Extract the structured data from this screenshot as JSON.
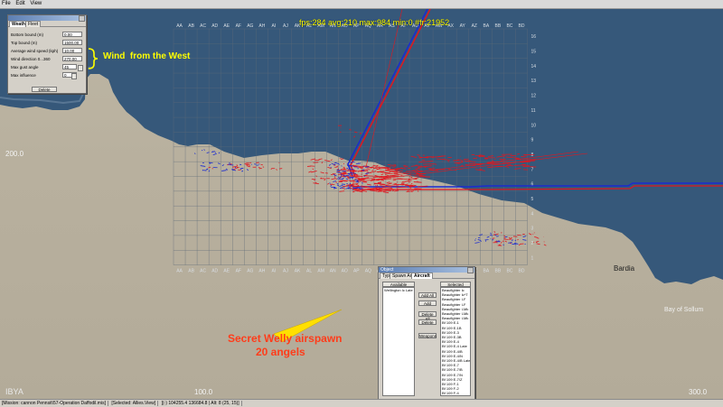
{
  "menu": [
    "File",
    "Edit",
    "View"
  ],
  "fps": "fps:284 avg:210 max:984 min:0 #fr:21952",
  "weather_window": {
    "tabs": [
      "Weather",
      "Fleet"
    ],
    "rows": [
      {
        "label": "Bottom bound (m)",
        "value": "0.00"
      },
      {
        "label": "Top bound (m)",
        "value": "1500.00"
      },
      {
        "label": "Average wind speed (kph)",
        "value": "10.00"
      },
      {
        "label": "Wind direction 0...360",
        "value": "270.00"
      },
      {
        "label": "Max gust angle",
        "value": "45"
      },
      {
        "label": "Max influence",
        "value": "0"
      }
    ],
    "delete_label": "Delete"
  },
  "wind_annotation": "Wind  from the West",
  "object_window": {
    "title": "Object",
    "tabs": [
      "Type",
      "Spawn Area",
      "Aircraft"
    ],
    "available_header": "Available",
    "available_items": [
      "Wellington Ic Late"
    ],
    "buttons": [
      "Add All",
      "Add",
      "Delete All",
      "Delete",
      "Weapons"
    ],
    "selected_header": "Selected",
    "selected_items": [
      "Beaufighter Ic",
      "Beaufighter Ic*T",
      "Beaufighter I-F",
      "Beaufighter I-F",
      "Beaufighter I-Mk",
      "Beaufighter I-Mk",
      "Beaufighter I-Mk",
      "Bf 109 E-1",
      "Bf 109 E-1B",
      "Bf 109 E-3",
      "Bf 109 E-3B",
      "Bf 109 E-4",
      "Bf 109 E-4 Late",
      "Bf 109 E-4/B",
      "Bf 109 E-4/N",
      "Bf 109 E-4/B Late",
      "Bf 109 E-7",
      "Bf 109 E-7/B",
      "Bf 109 E-7/N",
      "Bf 109 E-7/Z",
      "Bf 109 F-1",
      "Bf 109 F-2",
      "Bf 109 F-4",
      "Bf 109 F-4 Trop"
    ]
  },
  "annotation_secret": [
    "Secret Welly airspawn",
    "20 angels"
  ],
  "places": {
    "bardia": "Bardia",
    "bay": "Bay of Sollum",
    "libya": "IBYA"
  },
  "coords": {
    "c200": "200.0",
    "c100": "100.0",
    "c300": "300.0"
  },
  "grid": {
    "cols": [
      "AA",
      "AB",
      "AC",
      "AD",
      "AE",
      "AF",
      "AG",
      "AH",
      "AI",
      "AJ",
      "AK",
      "AL",
      "AM",
      "AN",
      "AO",
      "AP",
      "AQ",
      "AR",
      "AS",
      "AT",
      "AU",
      "AV",
      "AW",
      "AX",
      "AY",
      "AZ",
      "BA",
      "BB",
      "BC",
      "BD"
    ],
    "rows": [
      "16",
      "15",
      "14",
      "13",
      "12",
      "11",
      "10",
      "9",
      "8",
      "7",
      "6",
      "5",
      "4",
      "3",
      "2",
      "1"
    ]
  },
  "status": [
    "[Mission: cannon Pennsit\\57-Operation Daffodil.mis]",
    "[Selected: Allies.View]",
    "[(-) 104255.4 136684.8 | Alt: 8 (25, 15)]"
  ],
  "colors": {
    "red": "#e0171f",
    "blue": "#1a2bd0",
    "yellow": "#ffff00"
  }
}
